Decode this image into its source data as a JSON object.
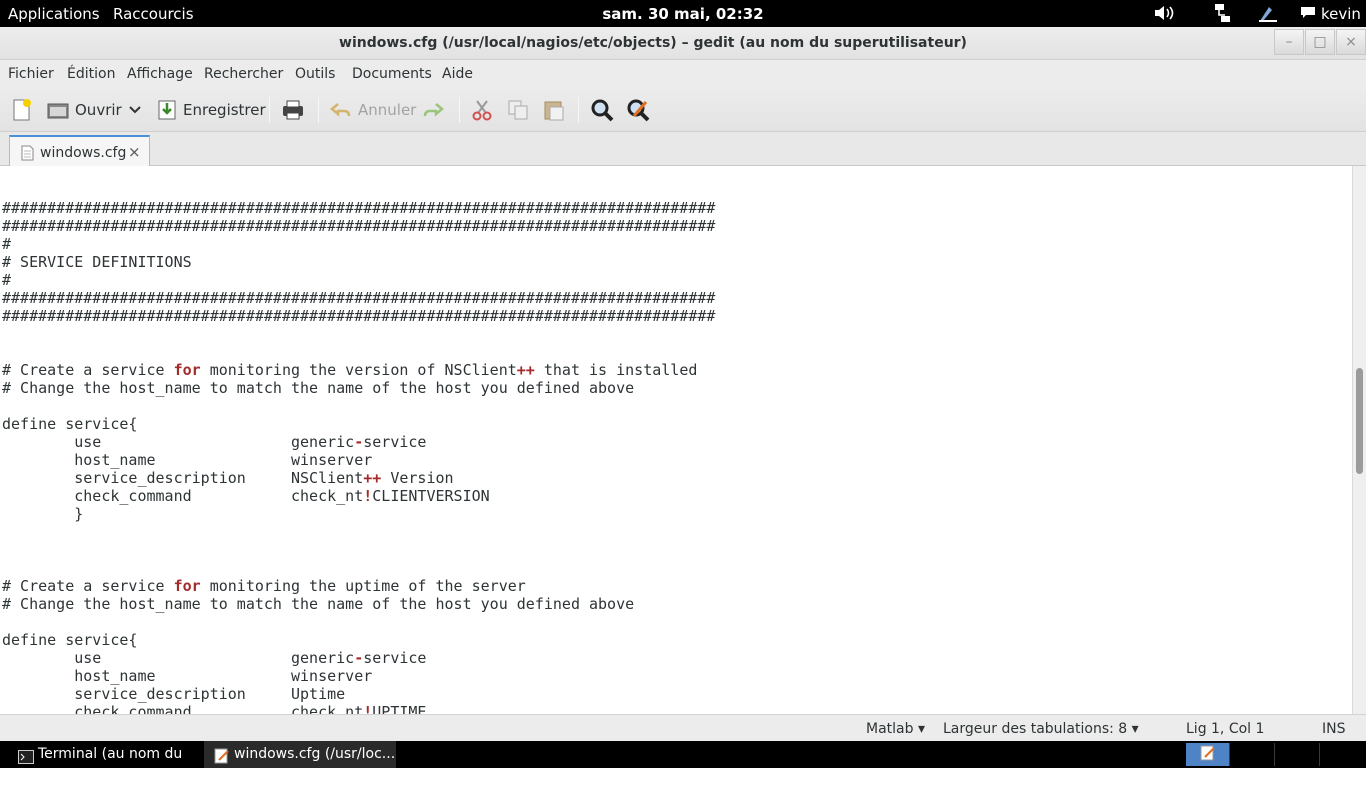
{
  "top_panel": {
    "applications": "Applications",
    "shortcuts": "Raccourcis",
    "clock": "sam. 30 mai, 02:32",
    "user": "kevin"
  },
  "window": {
    "title": "windows.cfg (/usr/local/nagios/etc/objects) – gedit (au nom du superutilisateur)",
    "minimize": "–",
    "maximize": "□",
    "close": "×"
  },
  "menubar": [
    "Fichier",
    "Édition",
    "Affichage",
    "Rechercher",
    "Outils",
    "Documents",
    "Aide"
  ],
  "toolbar": {
    "open_label": "Ouvrir",
    "save_label": "Enregistrer",
    "undo_label": "Annuler"
  },
  "tab": {
    "label": "windows.cfg",
    "close": "×"
  },
  "status": {
    "language": "Matlab",
    "tab_width_label": "Largeur des tabulations:",
    "tab_width": "8",
    "position": "Lig 1, Col 1",
    "mode": "INS"
  },
  "taskbar": {
    "items": [
      "Terminal (au nom du ...",
      "windows.cfg (/usr/loc..."
    ]
  },
  "code_lines": [
    "###############################################################################",
    "###############################################################################",
    "#",
    "# SERVICE DEFINITIONS",
    "#",
    "###############################################################################",
    "###############################################################################",
    "",
    "",
    "# Create a service for monitoring the version of NSClient++ that is installed",
    "# Change the host_name to match the name of the host you defined above",
    "",
    "define service{",
    "\tuse\t\t\tgeneric-service",
    "\thost_name\t\twinserver",
    "\tservice_description\tNSClient++ Version",
    "\tcheck_command\t\tcheck_nt!CLIENTVERSION",
    "\t}",
    "",
    "",
    "",
    "# Create a service for monitoring the uptime of the server",
    "# Change the host_name to match the name of the host you defined above",
    "",
    "define service{",
    "\tuse\t\t\tgeneric-service",
    "\thost_name\t\twinserver",
    "\tservice_description\tUptime",
    "\tcheck_command\t\tcheck_nt!UPTIME"
  ]
}
